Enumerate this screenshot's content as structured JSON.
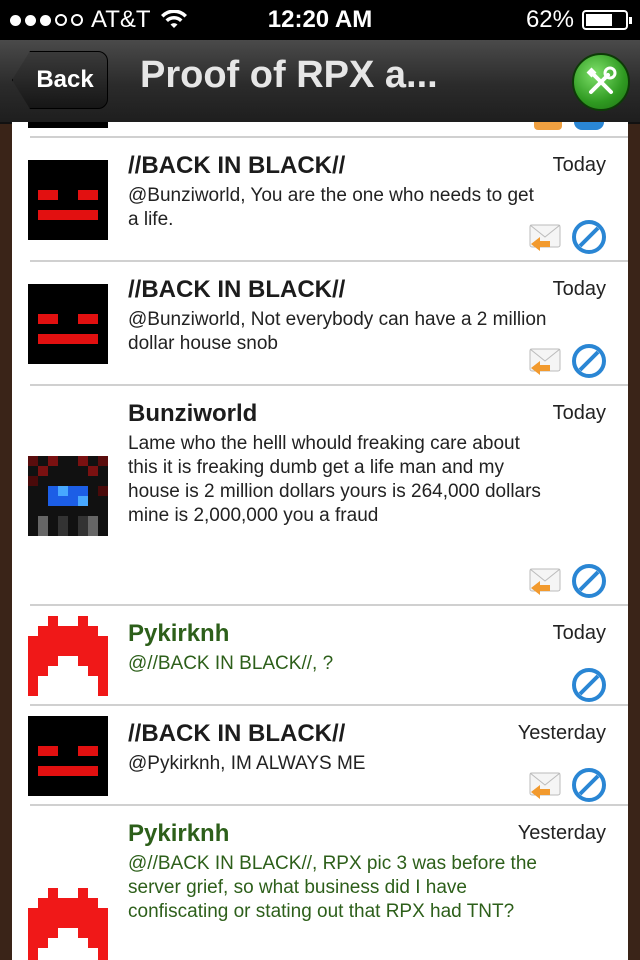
{
  "status_bar": {
    "carrier": "AT&T",
    "time": "12:20 AM",
    "battery": "62%"
  },
  "nav": {
    "back_label": "Back",
    "title": "Proof of RPX a..."
  },
  "messages": [
    {
      "author": "//BACK IN BLACK//",
      "date": "Today",
      "text": "@Bunziworld, You are the one who needs to get a life.",
      "avatar": "black-face-avatar",
      "author_color": "#1c1c1c"
    },
    {
      "author": "//BACK IN BLACK//",
      "date": "Today",
      "text": "@Bunziworld, Not everybody can have a 2 million dollar house snob",
      "avatar": "black-face-avatar",
      "author_color": "#1c1c1c"
    },
    {
      "author": "Bunziworld",
      "date": "Today",
      "text": "Lame who the helll whould freaking care about this it is freaking dumb get a life man and my house is 2 million dollars yours is 264,000 dollars mine is 2,000,000 you a fraud",
      "avatar": "blue-eyed-creature-avatar",
      "author_color": "#1c1c1c"
    },
    {
      "author": "Pykirknh",
      "date": "Today",
      "text": "@//BACK IN BLACK//, ?",
      "avatar": "fire-avatar",
      "author_color": "#2d5f1a"
    },
    {
      "author": "//BACK IN BLACK//",
      "date": "Yesterday",
      "text": "@Pykirknh, IM ALWAYS ME",
      "avatar": "black-face-avatar",
      "author_color": "#1c1c1c"
    },
    {
      "author": "Pykirknh",
      "date": "Yesterday",
      "text": "@//BACK IN BLACK//, RPX pic 3 was before the server grief, so what business did I have confiscating or stating out that RPX had TNT?",
      "avatar": "fire-avatar",
      "author_color": "#2d5f1a"
    }
  ]
}
